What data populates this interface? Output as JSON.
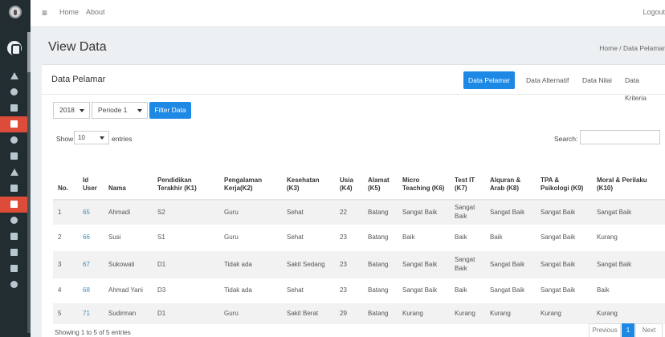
{
  "topbar": {
    "home": "Home",
    "about": "About",
    "logout": "Logout"
  },
  "header": {
    "title": "View Data",
    "breadcrumb": "Home / Data Pelamar"
  },
  "box": {
    "title": "Data Pelamar",
    "tabs": [
      "Data Pelamar",
      "Data Alternatif",
      "Data Nilai",
      "Data Kriteria"
    ]
  },
  "filter": {
    "year": "2018",
    "period": "Periode 1",
    "button": "Filter Data"
  },
  "table_controls": {
    "show": "Show",
    "entries_value": "10",
    "entries": "entries",
    "search_label": "Search:"
  },
  "table": {
    "headers": [
      "No.",
      "Id User",
      "Nama",
      "Pendidikan Terakhir (K1)",
      "Pengalaman Kerja(K2)",
      "Kesehatan (K3)",
      "Usia (K4)",
      "Alamat (K5)",
      "Micro Teaching (K6)",
      "Test IT (K7)",
      "Alquran & Arab (K8)",
      "TPA & Psikologi (K9)",
      "Moral & Perilaku (K10)"
    ],
    "rows": [
      [
        "1",
        "65",
        "Ahmadi",
        "S2",
        "Guru",
        "Sehat",
        "22",
        "Batang",
        "Sangat Baik",
        "Sangat Baik",
        "Sangat Baik",
        "Sangat Baik",
        "Sangat Baik"
      ],
      [
        "2",
        "66",
        "Susi",
        "S1",
        "Guru",
        "Sehat",
        "23",
        "Batang",
        "Baik",
        "Baik",
        "Baik",
        "Sangat Baik",
        "Kurang"
      ],
      [
        "3",
        "67",
        "Sukowati",
        "D1",
        "Tidak ada",
        "Sakit Sedang",
        "23",
        "Batang",
        "Sangat Baik",
        "Sangat Baik",
        "Sangat Baik",
        "Sangat Baik",
        "Sangat Baik"
      ],
      [
        "4",
        "68",
        "Ahmad Yani",
        "D3",
        "Tidak ada",
        "Sehat",
        "23",
        "Batang",
        "Sangat Baik",
        "Baik",
        "Sangat Baik",
        "Sangat Baik",
        "Baik"
      ],
      [
        "5",
        "71",
        "Sudirman",
        "D1",
        "Guru",
        "Sakit Berat",
        "29",
        "Batang",
        "Kurang",
        "Kurang",
        "Kurang",
        "Kurang",
        "Kurang"
      ]
    ]
  },
  "footer": {
    "info": "Showing 1 to 5 of 5 entries",
    "previous": "Previous",
    "page": "1",
    "next": "Next"
  },
  "sidebar": {
    "icons": [
      "home-icon",
      "user-icon",
      "file-icon",
      "calculator-icon",
      "diamond-icon",
      "table-icon",
      "bank-icon",
      "list-icon",
      "tag-icon",
      "user-icon",
      "bar-chart-icon",
      "list-icon",
      "line-chart-icon",
      "share-icon"
    ]
  },
  "colors": {
    "accent": "#1e88e5",
    "sidebar": "#222d32",
    "active": "#dd4b39"
  }
}
